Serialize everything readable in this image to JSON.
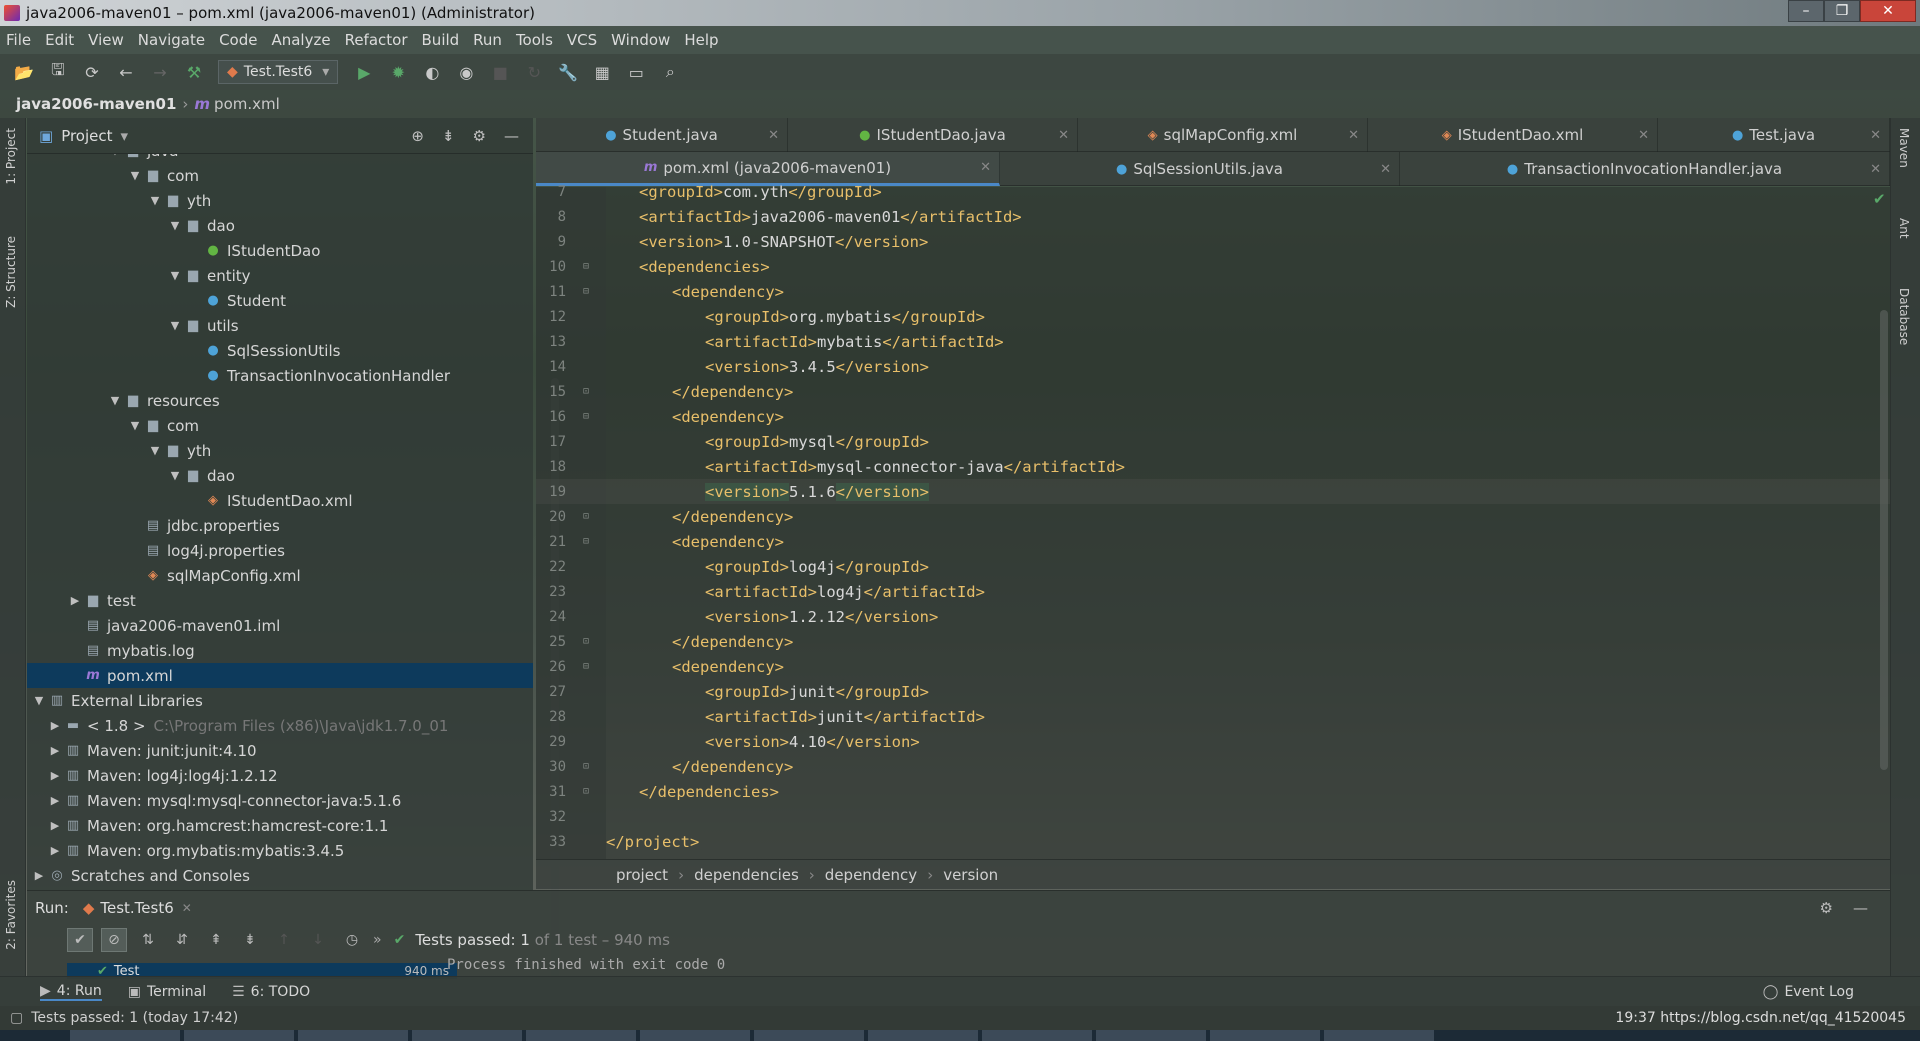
{
  "window": {
    "title": "java2006-maven01 – pom.xml (java2006-maven01) (Administrator)",
    "controls": [
      "–",
      "❐",
      "✕"
    ]
  },
  "menu": [
    "File",
    "Edit",
    "View",
    "Navigate",
    "Code",
    "Analyze",
    "Refactor",
    "Build",
    "Run",
    "Tools",
    "VCS",
    "Window",
    "Help"
  ],
  "toolbar": {
    "run_config": "Test.Test6"
  },
  "nav": {
    "project": "java2006-maven01",
    "file": "pom.xml"
  },
  "left_strip": {
    "project_tab": "1: Project",
    "structure_tab": "Z: Structure",
    "favorites_tab": "2: Favorites"
  },
  "right_strip": {
    "maven_tab": "Maven",
    "ant_tab": "Ant",
    "database_tab": "Database"
  },
  "project_panel": {
    "title": "Project",
    "tree": [
      {
        "label": "java",
        "arrow": "▼",
        "icon": "folder"
      },
      {
        "label": "com",
        "arrow": "▼",
        "icon": "folder"
      },
      {
        "label": "yth",
        "arrow": "▼",
        "icon": "folder"
      },
      {
        "label": "dao",
        "arrow": "▼",
        "icon": "folder"
      },
      {
        "label": "IStudentDao",
        "arrow": "",
        "icon": "interface"
      },
      {
        "label": "entity",
        "arrow": "▼",
        "icon": "folder"
      },
      {
        "label": "Student",
        "arrow": "",
        "icon": "class"
      },
      {
        "label": "utils",
        "arrow": "▼",
        "icon": "folder"
      },
      {
        "label": "SqlSessionUtils",
        "arrow": "",
        "icon": "class"
      },
      {
        "label": "TransactionInvocationHandler",
        "arrow": "",
        "icon": "class"
      },
      {
        "label": "resources",
        "arrow": "▼",
        "icon": "folder"
      },
      {
        "label": "com",
        "arrow": "▼",
        "icon": "folder"
      },
      {
        "label": "yth",
        "arrow": "▼",
        "icon": "folder"
      },
      {
        "label": "dao",
        "arrow": "▼",
        "icon": "folder"
      },
      {
        "label": "IStudentDao.xml",
        "arrow": "",
        "icon": "xml"
      },
      {
        "label": "jdbc.properties",
        "arrow": "",
        "icon": "properties"
      },
      {
        "label": "log4j.properties",
        "arrow": "",
        "icon": "properties"
      },
      {
        "label": "sqlMapConfig.xml",
        "arrow": "",
        "icon": "xml"
      },
      {
        "label": "test",
        "arrow": "▶",
        "icon": "folder"
      },
      {
        "label": "java2006-maven01.iml",
        "arrow": "",
        "icon": "file"
      },
      {
        "label": "mybatis.log",
        "arrow": "",
        "icon": "file"
      },
      {
        "label": "pom.xml",
        "arrow": "",
        "icon": "maven",
        "selected": true
      },
      {
        "label": "External Libraries",
        "arrow": "▼",
        "icon": "library"
      },
      {
        "label": "< 1.8 >",
        "arrow": "▶",
        "icon": "jdk",
        "path": "C:\\Program Files (x86)\\Java\\jdk1.7.0_01"
      },
      {
        "label": "Maven: junit:junit:4.10",
        "arrow": "▶",
        "icon": "library"
      },
      {
        "label": "Maven: log4j:log4j:1.2.12",
        "arrow": "▶",
        "icon": "library"
      },
      {
        "label": "Maven: mysql:mysql-connector-java:5.1.6",
        "arrow": "▶",
        "icon": "library"
      },
      {
        "label": "Maven: org.hamcrest:hamcrest-core:1.1",
        "arrow": "▶",
        "icon": "library"
      },
      {
        "label": "Maven: org.mybatis:mybatis:3.4.5",
        "arrow": "▶",
        "icon": "library"
      },
      {
        "label": "Scratches and Consoles",
        "arrow": "▶",
        "icon": "scratch"
      }
    ]
  },
  "editor": {
    "tabs_row1": [
      {
        "label": "Student.java",
        "icon": "class"
      },
      {
        "label": "IStudentDao.java",
        "icon": "interface"
      },
      {
        "label": "sqlMapConfig.xml",
        "icon": "xml"
      },
      {
        "label": "IStudentDao.xml",
        "icon": "xml"
      },
      {
        "label": "Test.java",
        "icon": "class"
      }
    ],
    "tabs_row2": [
      {
        "label": "pom.xml (java2006-maven01)",
        "icon": "maven",
        "active": true
      },
      {
        "label": "SqlSessionUtils.java",
        "icon": "class"
      },
      {
        "label": "TransactionInvocationHandler.java",
        "icon": "class"
      }
    ],
    "current_line": 19,
    "lines": [
      {
        "n": "7",
        "indent": 1,
        "tag": "groupId",
        "text": "com.yth"
      },
      {
        "n": "8",
        "indent": 1,
        "tag": "artifactId",
        "text": "java2006-maven01"
      },
      {
        "n": "9",
        "indent": 1,
        "tag": "version",
        "text": "1.0-SNAPSHOT"
      },
      {
        "n": "10",
        "indent": 1,
        "open": "dependencies"
      },
      {
        "n": "11",
        "indent": 2,
        "open": "dependency"
      },
      {
        "n": "12",
        "indent": 3,
        "tag": "groupId",
        "text": "org.mybatis"
      },
      {
        "n": "13",
        "indent": 3,
        "tag": "artifactId",
        "text": "mybatis"
      },
      {
        "n": "14",
        "indent": 3,
        "tag": "version",
        "text": "3.4.5"
      },
      {
        "n": "15",
        "indent": 2,
        "close": "dependency"
      },
      {
        "n": "16",
        "indent": 2,
        "open": "dependency"
      },
      {
        "n": "17",
        "indent": 3,
        "tag": "groupId",
        "text": "mysql"
      },
      {
        "n": "18",
        "indent": 3,
        "tag": "artifactId",
        "text": "mysql-connector-java"
      },
      {
        "n": "19",
        "indent": 3,
        "tag": "version",
        "text": "5.1.6"
      },
      {
        "n": "20",
        "indent": 2,
        "close": "dependency"
      },
      {
        "n": "21",
        "indent": 2,
        "open": "dependency"
      },
      {
        "n": "22",
        "indent": 3,
        "tag": "groupId",
        "text": "log4j"
      },
      {
        "n": "23",
        "indent": 3,
        "tag": "artifactId",
        "text": "log4j"
      },
      {
        "n": "24",
        "indent": 3,
        "tag": "version",
        "text": "1.2.12"
      },
      {
        "n": "25",
        "indent": 2,
        "close": "dependency"
      },
      {
        "n": "26",
        "indent": 2,
        "open": "dependency"
      },
      {
        "n": "27",
        "indent": 3,
        "tag": "groupId",
        "text": "junit"
      },
      {
        "n": "28",
        "indent": 3,
        "tag": "artifactId",
        "text": "junit"
      },
      {
        "n": "29",
        "indent": 3,
        "tag": "version",
        "text": "4.10"
      },
      {
        "n": "30",
        "indent": 2,
        "close": "dependency"
      },
      {
        "n": "31",
        "indent": 1,
        "close": "dependencies"
      },
      {
        "n": "32",
        "indent": 0
      },
      {
        "n": "33",
        "indent": 0,
        "close": "project"
      }
    ],
    "breadcrumb": [
      "project",
      "dependencies",
      "dependency",
      "version"
    ]
  },
  "run_panel": {
    "label": "Run:",
    "tab": "Test.Test6",
    "tests_passed": "Tests passed: 1",
    "tests_detail": "of 1 test – 940 ms",
    "tree_item": "Test",
    "tree_time": "940 ms",
    "console": "Process finished with exit code 0"
  },
  "bottom_tools": {
    "run": "4: Run",
    "terminal": "Terminal",
    "todo": "6: TODO",
    "event_log": "Event Log"
  },
  "status": {
    "left": "Tests passed: 1 (today 17:42)",
    "right": "19:37   https://blog.csdn.net/qq_41520045"
  },
  "colors": {
    "tag": "#e8bf6a",
    "selection": "#0d3a5c",
    "active_tab_underline": "#4a88c7",
    "success": "#59a869"
  }
}
